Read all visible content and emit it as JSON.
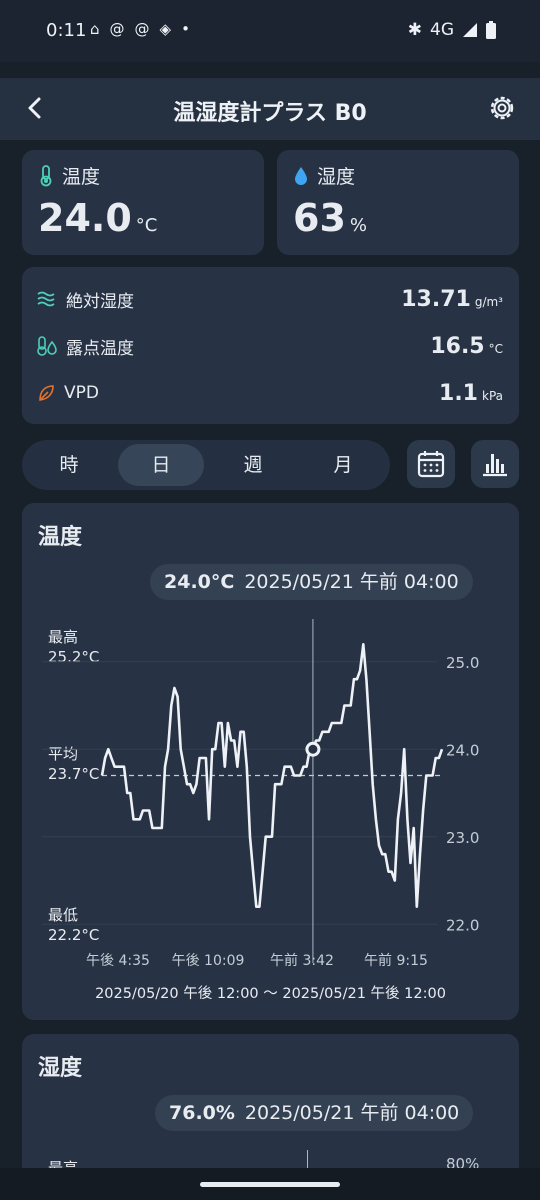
{
  "status_bar": {
    "time": "0:11",
    "network": "4G",
    "icons": [
      "discord-icon",
      "threads-icon",
      "threads-icon",
      "app-icon",
      "dot-icon"
    ],
    "right_icons": [
      "bluetooth-icon",
      "signal-icon",
      "battery-icon"
    ]
  },
  "app_bar": {
    "title": "温湿度計プラス B0",
    "back_icon": "back-arrow-icon",
    "settings_icon": "gear-icon"
  },
  "temperature_card": {
    "label": "温度",
    "value": "24.0",
    "unit": "°C",
    "icon": "thermometer-icon",
    "icon_color": "#4dd0b5"
  },
  "humidity_card": {
    "label": "湿度",
    "value": "63",
    "unit": "%",
    "icon": "droplet-icon",
    "icon_color": "#3fa4f2"
  },
  "details": [
    {
      "label": "絶対湿度",
      "value": "13.71",
      "unit": "g/m³",
      "icon": "wind-icon",
      "icon_color": "#4dd0b5"
    },
    {
      "label": "露点温度",
      "value": "16.5",
      "unit": "°C",
      "icon": "dew-point-icon",
      "icon_color": "#4dd0b5"
    },
    {
      "label": "VPD",
      "value": "1.1",
      "unit": "kPa",
      "icon": "leaf-icon",
      "icon_color": "#e2732d"
    }
  ],
  "period_tabs": [
    {
      "label": "時",
      "active": false
    },
    {
      "label": "日",
      "active": true
    },
    {
      "label": "週",
      "active": false
    },
    {
      "label": "月",
      "active": false
    }
  ],
  "buttons": {
    "calendar_icon": "calendar-icon",
    "chart_icon": "bar-chart-icon"
  },
  "temp_chart_card": {
    "title": "温度",
    "tooltip_value": "24.0°C",
    "tooltip_time": "2025/05/21 午前 04:00",
    "max_label": "最高",
    "max_value": "25.2°C",
    "avg_label": "平均",
    "avg_value": "23.7°C",
    "min_label": "最低",
    "min_value": "22.2°C",
    "range": "2025/05/20 午後 12:00 〜 2025/05/21 午後 12:00"
  },
  "chart_data": {
    "type": "line",
    "title": "温度",
    "ylim": [
      21.9,
      25.5
    ],
    "y_ticks": [
      "25.0",
      "24.0",
      "23.0",
      "22.0"
    ],
    "x_ticks": [
      "午後 4:35",
      "午後 10:09",
      "午前 3:42",
      "午前 9:15"
    ],
    "avg": 23.7,
    "cursor_index": 67,
    "values": [
      23.7,
      23.9,
      24.0,
      23.9,
      23.8,
      23.8,
      23.8,
      23.8,
      23.5,
      23.5,
      23.2,
      23.2,
      23.2,
      23.3,
      23.3,
      23.3,
      23.1,
      23.1,
      23.1,
      23.1,
      23.8,
      24.0,
      24.5,
      24.7,
      24.6,
      24.0,
      23.8,
      23.6,
      23.6,
      23.5,
      23.6,
      23.9,
      23.9,
      23.9,
      23.2,
      24.0,
      24.0,
      24.3,
      24.3,
      23.8,
      24.3,
      24.1,
      24.1,
      23.8,
      24.2,
      24.2,
      23.8,
      23.0,
      22.6,
      22.2,
      22.2,
      22.6,
      23.0,
      23.0,
      23.0,
      23.6,
      23.6,
      23.6,
      23.8,
      23.8,
      23.8,
      23.7,
      23.7,
      23.7,
      23.8,
      23.8,
      24.0,
      24.0,
      24.1,
      24.1,
      24.2,
      24.2,
      24.2,
      24.3,
      24.3,
      24.3,
      24.3,
      24.5,
      24.5,
      24.5,
      24.8,
      24.8,
      24.9,
      25.2,
      24.8,
      24.2,
      23.6,
      23.2,
      22.9,
      22.8,
      22.8,
      22.6,
      22.6,
      22.5,
      23.2,
      23.5,
      24.0,
      23.2,
      22.7,
      23.1,
      22.2,
      22.8,
      23.3,
      23.7,
      23.7,
      23.7,
      23.9,
      23.9,
      24.0
    ]
  },
  "humidity_chart_card": {
    "title": "湿度",
    "tooltip_value": "76.0%",
    "tooltip_time": "2025/05/21 午前 04:00",
    "max_label": "最高",
    "top_tick": "80%"
  }
}
